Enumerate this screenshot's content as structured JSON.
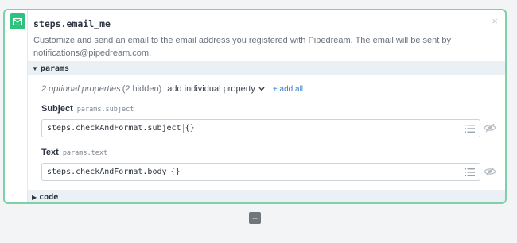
{
  "step": {
    "name": "steps.email_me",
    "description": "Customize and send an email to the email address you registered with Pipedream. The email will be sent by notifications@pipedream.com.",
    "close_glyph": "×",
    "app_icon": "envelope-icon",
    "accent_color": "#2ec27e"
  },
  "params_section": {
    "arrow": "▼",
    "label": "params",
    "optional_count": "2 optional properties",
    "optional_hidden": "(2 hidden)",
    "add_individual_label": "add individual property",
    "add_all_label": "+ add all"
  },
  "properties": [
    {
      "name": "Subject",
      "path": "params.subject",
      "value": "steps.checkAndFormat.subject",
      "braces": "{}"
    },
    {
      "name": "Text",
      "path": "params.text",
      "value": "steps.checkAndFormat.body",
      "braces": "{}"
    }
  ],
  "code_section": {
    "arrow": "▶",
    "label": "code"
  },
  "add_step": {
    "glyph": "+"
  }
}
